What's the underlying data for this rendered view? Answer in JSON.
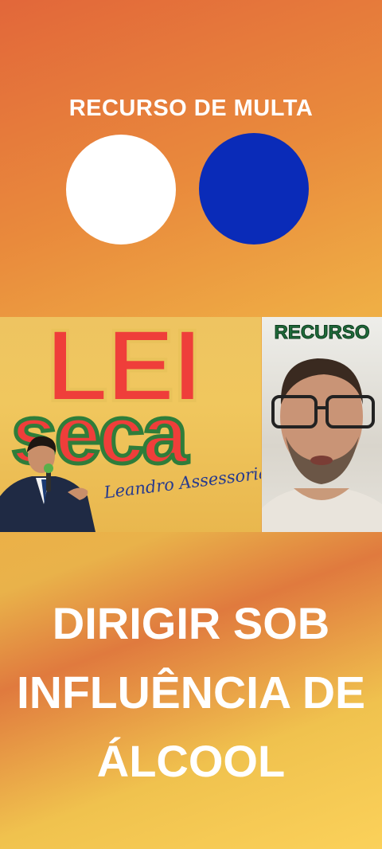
{
  "header": {
    "title": "RECURSO DE MULTA"
  },
  "circles": [
    {
      "name": "white-circle",
      "color": "#ffffff"
    },
    {
      "name": "blue-circle",
      "color": "#0a2bb8"
    }
  ],
  "banner": {
    "title_line1": "LEI",
    "title_line2": "seca",
    "signature": "Leandro Assessoria",
    "label": "RECURSO",
    "accent_red": "#ef3e3a",
    "accent_green": "#2f7d3a"
  },
  "caption": {
    "line1": "DIRIGIR SOB",
    "line2": "INFLUÊNCIA DE",
    "line3": "ÁLCOOL"
  }
}
